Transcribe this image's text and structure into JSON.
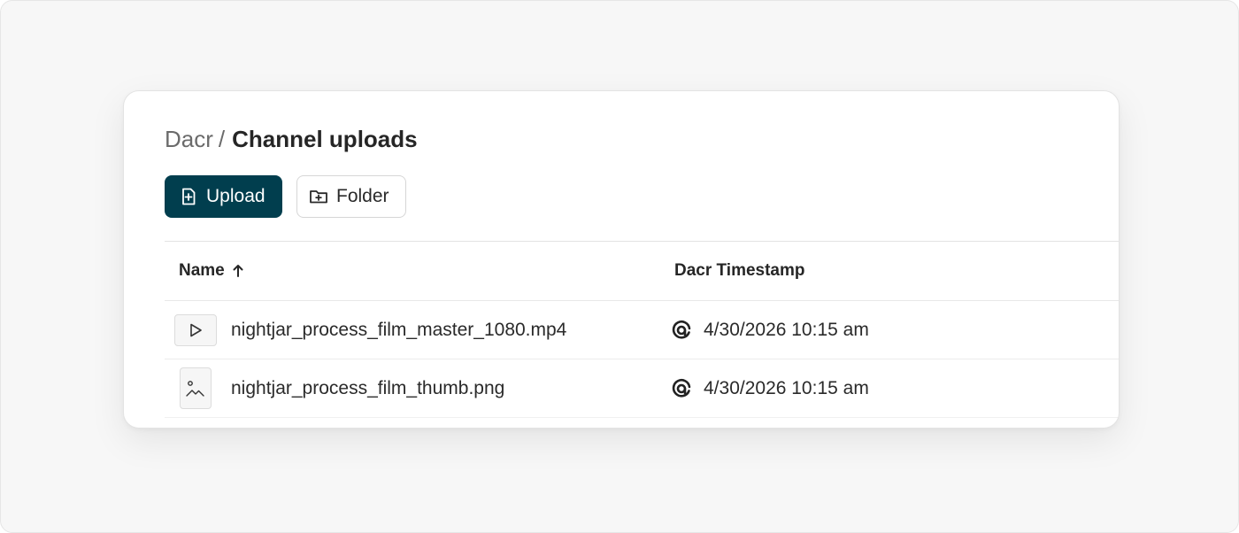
{
  "breadcrumb": {
    "root": "Dacr",
    "separator": "/",
    "current": "Channel uploads"
  },
  "toolbar": {
    "upload_label": "Upload",
    "upload_icon": "file-plus-icon",
    "folder_label": "Folder",
    "folder_icon": "folder-plus-icon"
  },
  "table": {
    "columns": {
      "name": "Name",
      "name_sort": "ascending",
      "timestamp": "Dacr Timestamp"
    },
    "rows": [
      {
        "type": "video",
        "icon": "play-icon",
        "name": "nightjar_process_film_master_1080.mp4",
        "timestamp_icon": "dacr-logo-icon",
        "timestamp": "4/30/2026 10:15 am"
      },
      {
        "type": "image",
        "icon": "image-icon",
        "name": "nightjar_process_film_thumb.png",
        "timestamp_icon": "dacr-logo-icon",
        "timestamp": "4/30/2026 10:15 am"
      }
    ]
  },
  "colors": {
    "primary": "#013e4e",
    "background": "#f7f7f7",
    "card": "#ffffff",
    "text": "#262626",
    "muted": "#6b6b6b"
  }
}
